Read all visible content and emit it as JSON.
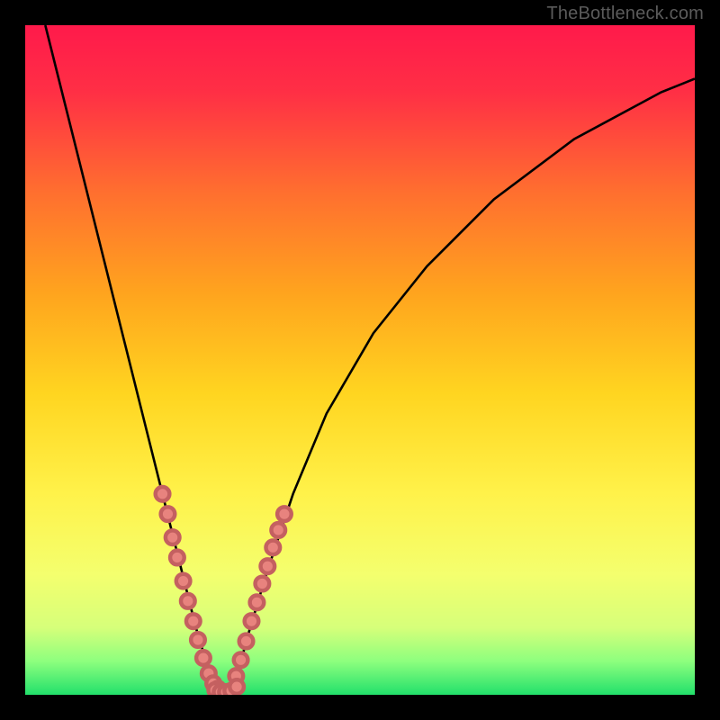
{
  "watermark": "TheBottleneck.com",
  "colors": {
    "frame": "#000000",
    "curve": "#000000",
    "dot_fill": "#e8837e",
    "dot_stroke": "#c46060",
    "gradient_stops": [
      {
        "offset": 0.0,
        "color": "#ff1a4b"
      },
      {
        "offset": 0.1,
        "color": "#ff2f45"
      },
      {
        "offset": 0.25,
        "color": "#ff6f2f"
      },
      {
        "offset": 0.4,
        "color": "#ffa41e"
      },
      {
        "offset": 0.55,
        "color": "#ffd520"
      },
      {
        "offset": 0.7,
        "color": "#fff24a"
      },
      {
        "offset": 0.82,
        "color": "#f4ff6e"
      },
      {
        "offset": 0.9,
        "color": "#d6ff7a"
      },
      {
        "offset": 0.95,
        "color": "#8dff7e"
      },
      {
        "offset": 1.0,
        "color": "#22e06b"
      }
    ]
  },
  "chart_data": {
    "type": "line",
    "title": "",
    "xlabel": "",
    "ylabel": "",
    "xlim": [
      0,
      100
    ],
    "ylim": [
      0,
      100
    ],
    "grid": false,
    "series": [
      {
        "name": "bottleneck-curve",
        "x": [
          3,
          6,
          9,
          12,
          15,
          18,
          20,
          22,
          24,
          25.5,
          27,
          28.5,
          30,
          31,
          32,
          33,
          36,
          40,
          45,
          52,
          60,
          70,
          82,
          95,
          100
        ],
        "y": [
          100,
          88,
          76,
          64,
          52,
          40,
          32,
          24,
          16,
          10,
          5,
          2,
          0.5,
          1.5,
          4,
          8,
          18,
          30,
          42,
          54,
          64,
          74,
          83,
          90,
          92
        ]
      }
    ],
    "points": [
      {
        "name": "left-cluster",
        "x": [
          20.5,
          21.3,
          22.0,
          22.7,
          23.6,
          24.3,
          25.1,
          25.8,
          26.6,
          27.4,
          28.1,
          28.8
        ],
        "y": [
          30.0,
          27.0,
          23.5,
          20.5,
          17.0,
          14.0,
          11.0,
          8.2,
          5.5,
          3.2,
          1.7,
          0.9
        ]
      },
      {
        "name": "right-cluster",
        "x": [
          31.5,
          32.2,
          33.0,
          33.8,
          34.6,
          35.4,
          36.2,
          37.0,
          37.8,
          38.7
        ],
        "y": [
          2.8,
          5.2,
          8.0,
          11.0,
          13.8,
          16.6,
          19.2,
          22.0,
          24.6,
          27.0
        ]
      },
      {
        "name": "bottom-cluster",
        "x": [
          28.4,
          29.2,
          30.0,
          30.8,
          31.6
        ],
        "y": [
          0.7,
          0.4,
          0.4,
          0.6,
          1.2
        ]
      }
    ]
  }
}
